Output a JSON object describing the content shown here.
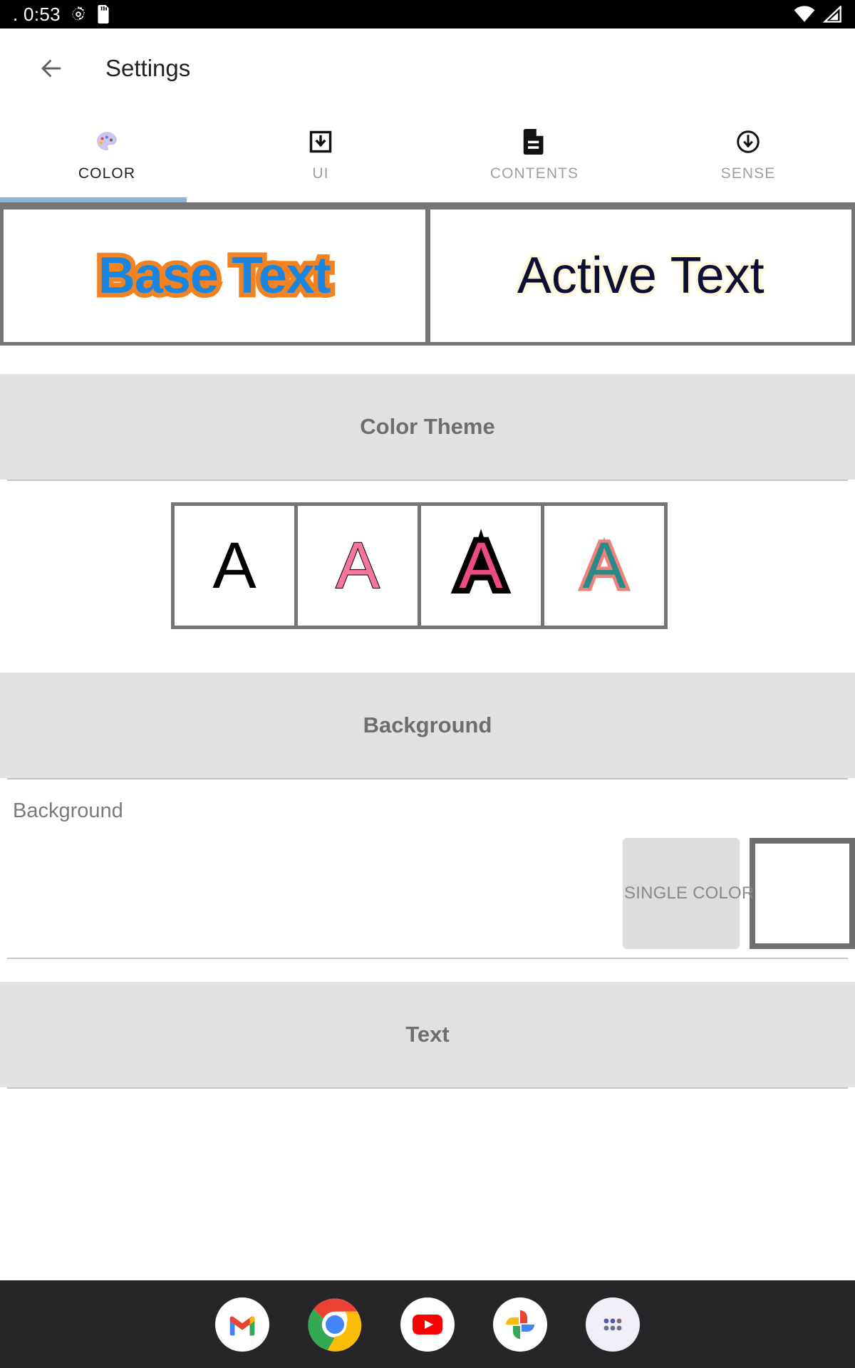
{
  "status_bar": {
    "clock": ". 0:53",
    "left_icons": [
      "gear-icon",
      "sd-card-icon"
    ],
    "right_icons": [
      "wifi-icon",
      "cell-signal-icon"
    ],
    "background": "#000000"
  },
  "app_bar": {
    "back_label": "back-arrow",
    "title": "Settings"
  },
  "tabs": {
    "active_index": 0,
    "indicator_color": "#8ab4dd",
    "items": [
      {
        "label": "COLOR",
        "icon": "palette-icon"
      },
      {
        "label": "UI",
        "icon": "download-box-icon"
      },
      {
        "label": "CONTENTS",
        "icon": "document-icon"
      },
      {
        "label": "SENSE",
        "icon": "circle-down-arrow-icon"
      }
    ]
  },
  "preview": {
    "base": {
      "text": "Base Text",
      "fill_color": "#1a86e0",
      "outline_color": "#f58220"
    },
    "active": {
      "text": "Active Text",
      "fill_color": "#0d0d35",
      "glow_color": "#fbf6cf"
    }
  },
  "sections": {
    "color_theme": {
      "title": "Color Theme",
      "swatches": [
        {
          "letter": "A",
          "fill": "#000000",
          "outline": "none"
        },
        {
          "letter": "A",
          "fill": "#f5759c",
          "outline": "#000000"
        },
        {
          "letter": "A",
          "fill": "#ed4b84",
          "outline": "#000000"
        },
        {
          "letter": "A",
          "fill": "#2a8a88",
          "outline": "#ef8179"
        }
      ]
    },
    "background": {
      "title": "Background",
      "row_label": "Background",
      "single_color_label": "SINGLE COLOR",
      "preview_color": "#ffffff"
    },
    "text": {
      "title": "Text"
    }
  },
  "dock": {
    "background": "#262629",
    "items": [
      {
        "name": "gmail",
        "icon": "gmail-icon"
      },
      {
        "name": "chrome",
        "icon": "chrome-icon"
      },
      {
        "name": "youtube",
        "icon": "youtube-icon"
      },
      {
        "name": "photos",
        "icon": "google-photos-icon"
      },
      {
        "name": "app-drawer",
        "icon": "app-drawer-icon"
      }
    ]
  }
}
